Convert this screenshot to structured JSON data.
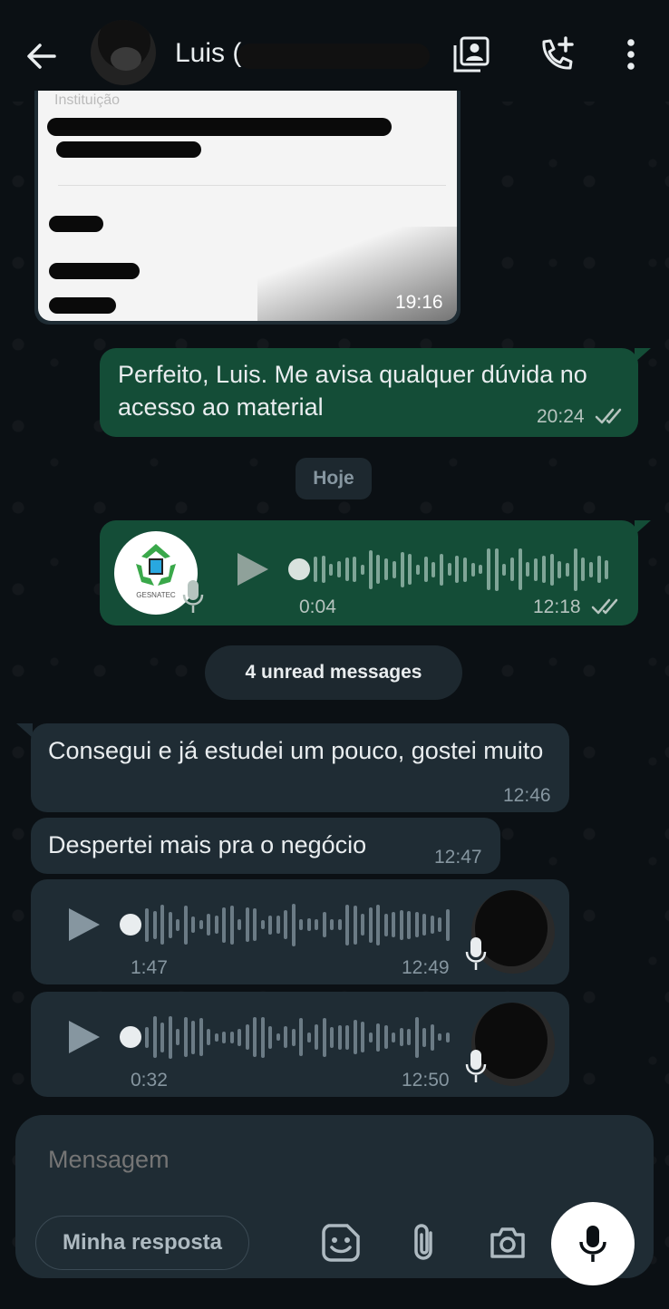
{
  "header": {
    "contact_name": "Luis (",
    "back_icon": "arrow-left-icon",
    "contacts_icon": "contact-card-icon",
    "call_icon": "add-call-icon",
    "menu_icon": "more-vert-icon"
  },
  "messages": [
    {
      "type": "document",
      "direction": "in",
      "label": "Instituição",
      "time": "19:16"
    },
    {
      "type": "text",
      "direction": "out",
      "text": "Perfeito, Luis. Me avisa qualquer dúvida no acesso ao material",
      "time": "20:24",
      "status": "read"
    },
    {
      "type": "day",
      "text": "Hoje"
    },
    {
      "type": "voice",
      "direction": "out",
      "duration": "0:04",
      "time": "12:18",
      "status": "read",
      "avatar_caption": "GESNATEC"
    },
    {
      "type": "unread",
      "text": "4 unread messages"
    },
    {
      "type": "text",
      "direction": "in",
      "text": "Consegui e já estudei um pouco, gostei muito",
      "time": "12:46"
    },
    {
      "type": "text",
      "direction": "in",
      "text": "Despertei mais pra o negócio",
      "time": "12:47"
    },
    {
      "type": "voice",
      "direction": "in",
      "duration": "1:47",
      "time": "12:49"
    },
    {
      "type": "voice",
      "direction": "in",
      "duration": "0:32",
      "time": "12:50"
    }
  ],
  "composer": {
    "placeholder": "Mensagem",
    "reply_chip": "Minha resposta",
    "icons": [
      "sticker-icon",
      "attach-icon",
      "camera-icon",
      "mic-icon"
    ]
  },
  "colors": {
    "background": "#0b1014",
    "incoming_bubble": "#1f2c34",
    "outgoing_bubble": "#144d37",
    "read_ticks": "#b6c4bf"
  }
}
